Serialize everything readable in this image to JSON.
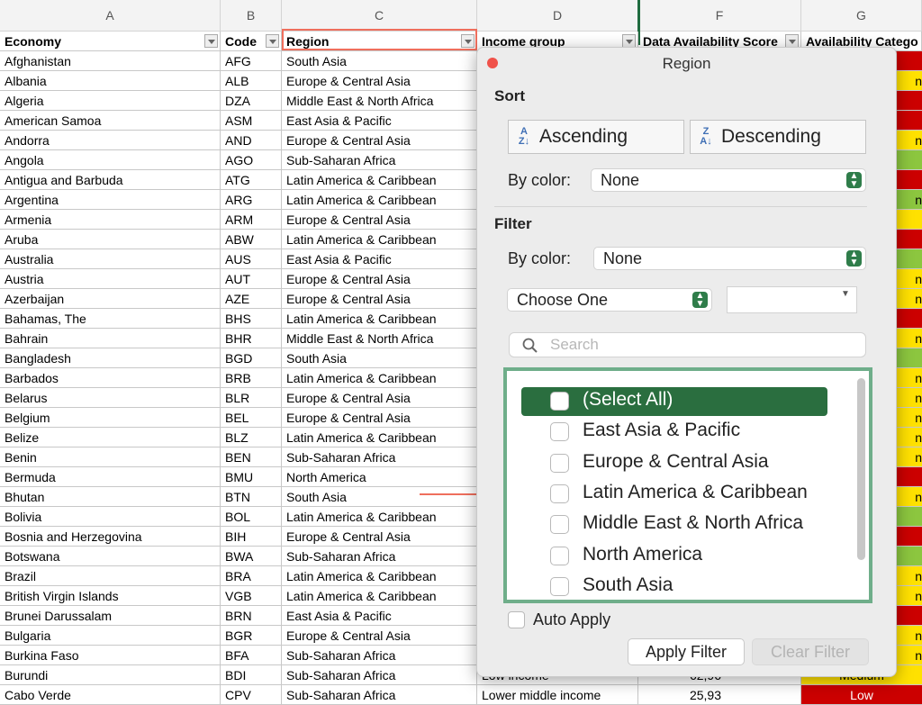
{
  "columns": [
    "A",
    "B",
    "C",
    "D",
    "F",
    "G"
  ],
  "headers": {
    "economy": "Economy",
    "code": "Code",
    "region": "Region",
    "income": "Income group",
    "score": "Data Availability Score",
    "category": "Availability Catego"
  },
  "rows": [
    [
      "Afghanistan",
      "AFG",
      "South Asia"
    ],
    [
      "Albania",
      "ALB",
      "Europe & Central Asia"
    ],
    [
      "Algeria",
      "DZA",
      "Middle East & North Africa"
    ],
    [
      "American Samoa",
      "ASM",
      "East Asia & Pacific"
    ],
    [
      "Andorra",
      "AND",
      "Europe & Central Asia"
    ],
    [
      "Angola",
      "AGO",
      "Sub-Saharan Africa"
    ],
    [
      "Antigua and Barbuda",
      "ATG",
      "Latin America & Caribbean"
    ],
    [
      "Argentina",
      "ARG",
      "Latin America & Caribbean"
    ],
    [
      "Armenia",
      "ARM",
      "Europe & Central Asia"
    ],
    [
      "Aruba",
      "ABW",
      "Latin America & Caribbean"
    ],
    [
      "Australia",
      "AUS",
      "East Asia & Pacific"
    ],
    [
      "Austria",
      "AUT",
      "Europe & Central Asia"
    ],
    [
      "Azerbaijan",
      "AZE",
      "Europe & Central Asia"
    ],
    [
      "Bahamas, The",
      "BHS",
      "Latin America & Caribbean"
    ],
    [
      "Bahrain",
      "BHR",
      "Middle East & North Africa"
    ],
    [
      "Bangladesh",
      "BGD",
      "South Asia"
    ],
    [
      "Barbados",
      "BRB",
      "Latin America & Caribbean"
    ],
    [
      "Belarus",
      "BLR",
      "Europe & Central Asia"
    ],
    [
      "Belgium",
      "BEL",
      "Europe & Central Asia"
    ],
    [
      "Belize",
      "BLZ",
      "Latin America & Caribbean"
    ],
    [
      "Benin",
      "BEN",
      "Sub-Saharan Africa"
    ],
    [
      "Bermuda",
      "BMU",
      "North America"
    ],
    [
      "Bhutan",
      "BTN",
      "South Asia"
    ],
    [
      "Bolivia",
      "BOL",
      "Latin America & Caribbean"
    ],
    [
      "Bosnia and Herzegovina",
      "BIH",
      "Europe & Central Asia"
    ],
    [
      "Botswana",
      "BWA",
      "Sub-Saharan Africa"
    ],
    [
      "Brazil",
      "BRA",
      "Latin America & Caribbean"
    ],
    [
      "British Virgin Islands",
      "VGB",
      "Latin America & Caribbean"
    ],
    [
      "Brunei Darussalam",
      "BRN",
      "East Asia & Pacific"
    ],
    [
      "Bulgaria",
      "BGR",
      "Europe & Central Asia"
    ],
    [
      "Burkina Faso",
      "BFA",
      "Sub-Saharan Africa"
    ],
    [
      "Burundi",
      "BDI",
      "Sub-Saharan Africa",
      "Low income",
      "62,96",
      "Medium"
    ],
    [
      "Cabo Verde",
      "CPV",
      "Sub-Saharan Africa",
      "Lower middle income",
      "25,93",
      "Low"
    ]
  ],
  "category_visible": [
    "",
    "n",
    "",
    "",
    "n",
    "",
    "",
    "n",
    "",
    "",
    "",
    "n",
    "n",
    "",
    "n",
    "",
    "n",
    "n",
    "n",
    "n",
    "n",
    "",
    "n",
    "",
    "",
    "",
    "n",
    "n",
    "",
    "n",
    "n",
    "Medium",
    "Low"
  ],
  "category_colors": {
    "red": "#cc0000",
    "yellow": "#ffe100",
    "green": "#8cc63f"
  },
  "category_fills": [
    "red",
    "yellow",
    "red",
    "red",
    "yellow",
    "green",
    "red",
    "green",
    "yellow",
    "red",
    "green",
    "yellow",
    "yellow",
    "red",
    "yellow",
    "green",
    "yellow",
    "yellow",
    "yellow",
    "yellow",
    "yellow",
    "red",
    "yellow",
    "green",
    "red",
    "green",
    "yellow",
    "yellow",
    "red",
    "yellow",
    "yellow",
    "yellow",
    "red"
  ],
  "panel": {
    "title": "Region",
    "sort_label": "Sort",
    "ascending": "Ascending",
    "descending": "Descending",
    "by_color_label": "By color:",
    "sort_color_value": "None",
    "filter_label": "Filter",
    "filter_color_value": "None",
    "choose_one": "Choose One",
    "search_placeholder": "Search",
    "items": [
      "(Select All)",
      "East Asia & Pacific",
      "Europe & Central Asia",
      "Latin America & Caribbean",
      "Middle East & North Africa",
      "North America",
      "South Asia"
    ],
    "auto_apply": "Auto Apply",
    "apply_filter": "Apply Filter",
    "clear_filter": "Clear Filter"
  }
}
